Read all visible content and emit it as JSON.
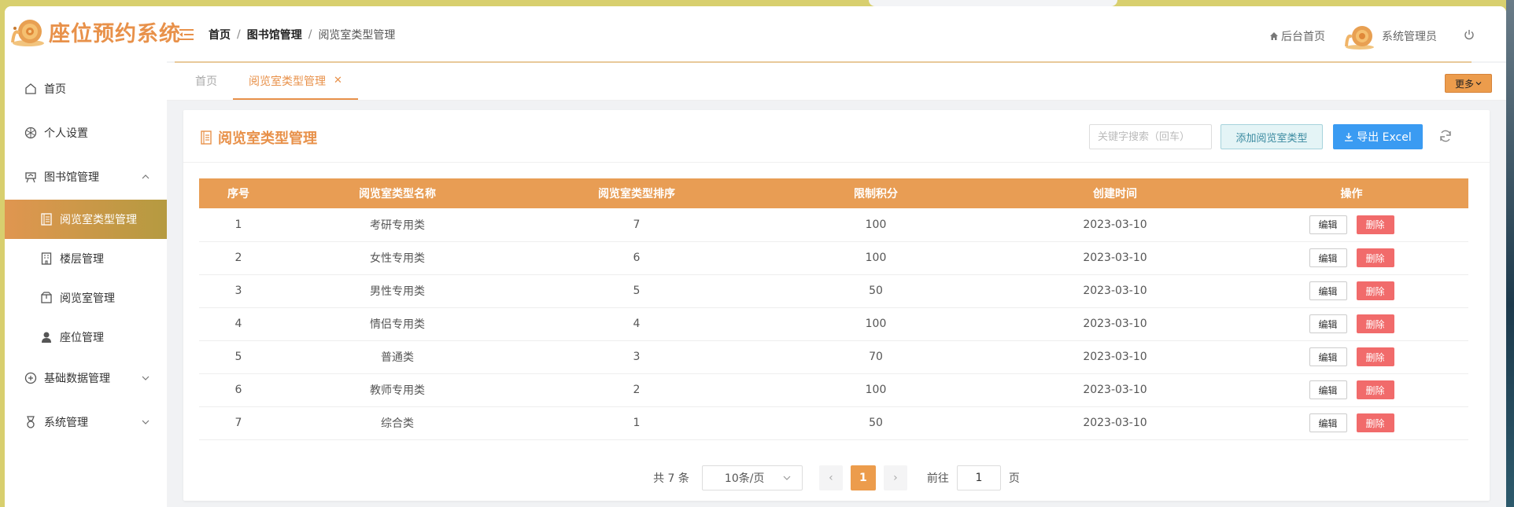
{
  "app": {
    "title": "座位预约系统"
  },
  "breadcrumb": [
    "首页",
    "图书馆管理",
    "阅览室类型管理"
  ],
  "header": {
    "home_link": "后台首页",
    "user_name": "系统管理员"
  },
  "sidebar": {
    "items": [
      {
        "label": "首页",
        "icon": "home-icon"
      },
      {
        "label": "个人设置",
        "icon": "settings-icon"
      },
      {
        "label": "图书馆管理",
        "icon": "library-icon",
        "expanded": true
      },
      {
        "label": "阅览室类型管理",
        "icon": "document-icon",
        "active": true
      },
      {
        "label": "楼层管理",
        "icon": "building-icon"
      },
      {
        "label": "阅览室管理",
        "icon": "box-icon"
      },
      {
        "label": "座位管理",
        "icon": "person-icon"
      },
      {
        "label": "基础数据管理",
        "icon": "database-icon",
        "expanded": false
      },
      {
        "label": "系统管理",
        "icon": "medal-icon",
        "expanded": false
      }
    ]
  },
  "tabs": {
    "home": "首页",
    "active": "阅览室类型管理",
    "more": "更多"
  },
  "card": {
    "title": "阅览室类型管理",
    "search_placeholder": "关键字搜索（回车）",
    "add_label": "添加阅览室类型",
    "export_label": "导出 Excel"
  },
  "table": {
    "headers": [
      "序号",
      "阅览室类型名称",
      "阅览室类型排序",
      "限制积分",
      "创建时间",
      "操作"
    ],
    "edit_label": "编辑",
    "delete_label": "删除",
    "rows": [
      [
        "1",
        "考研专用类",
        "7",
        "100",
        "2023-03-10"
      ],
      [
        "2",
        "女性专用类",
        "6",
        "100",
        "2023-03-10"
      ],
      [
        "3",
        "男性专用类",
        "5",
        "50",
        "2023-03-10"
      ],
      [
        "4",
        "情侣专用类",
        "4",
        "100",
        "2023-03-10"
      ],
      [
        "5",
        "普通类",
        "3",
        "70",
        "2023-03-10"
      ],
      [
        "6",
        "教师专用类",
        "2",
        "100",
        "2023-03-10"
      ],
      [
        "7",
        "综合类",
        "1",
        "50",
        "2023-03-10"
      ]
    ]
  },
  "pager": {
    "total": "共 7 条",
    "page_size": "10条/页",
    "current_page": "1",
    "goto_prefix": "前往",
    "goto_value": "1",
    "goto_suffix": "页"
  },
  "colors": {
    "accent": "#e8914a",
    "header_row": "#e89d54",
    "export": "#3a9bf2",
    "delete": "#f16b6b"
  }
}
